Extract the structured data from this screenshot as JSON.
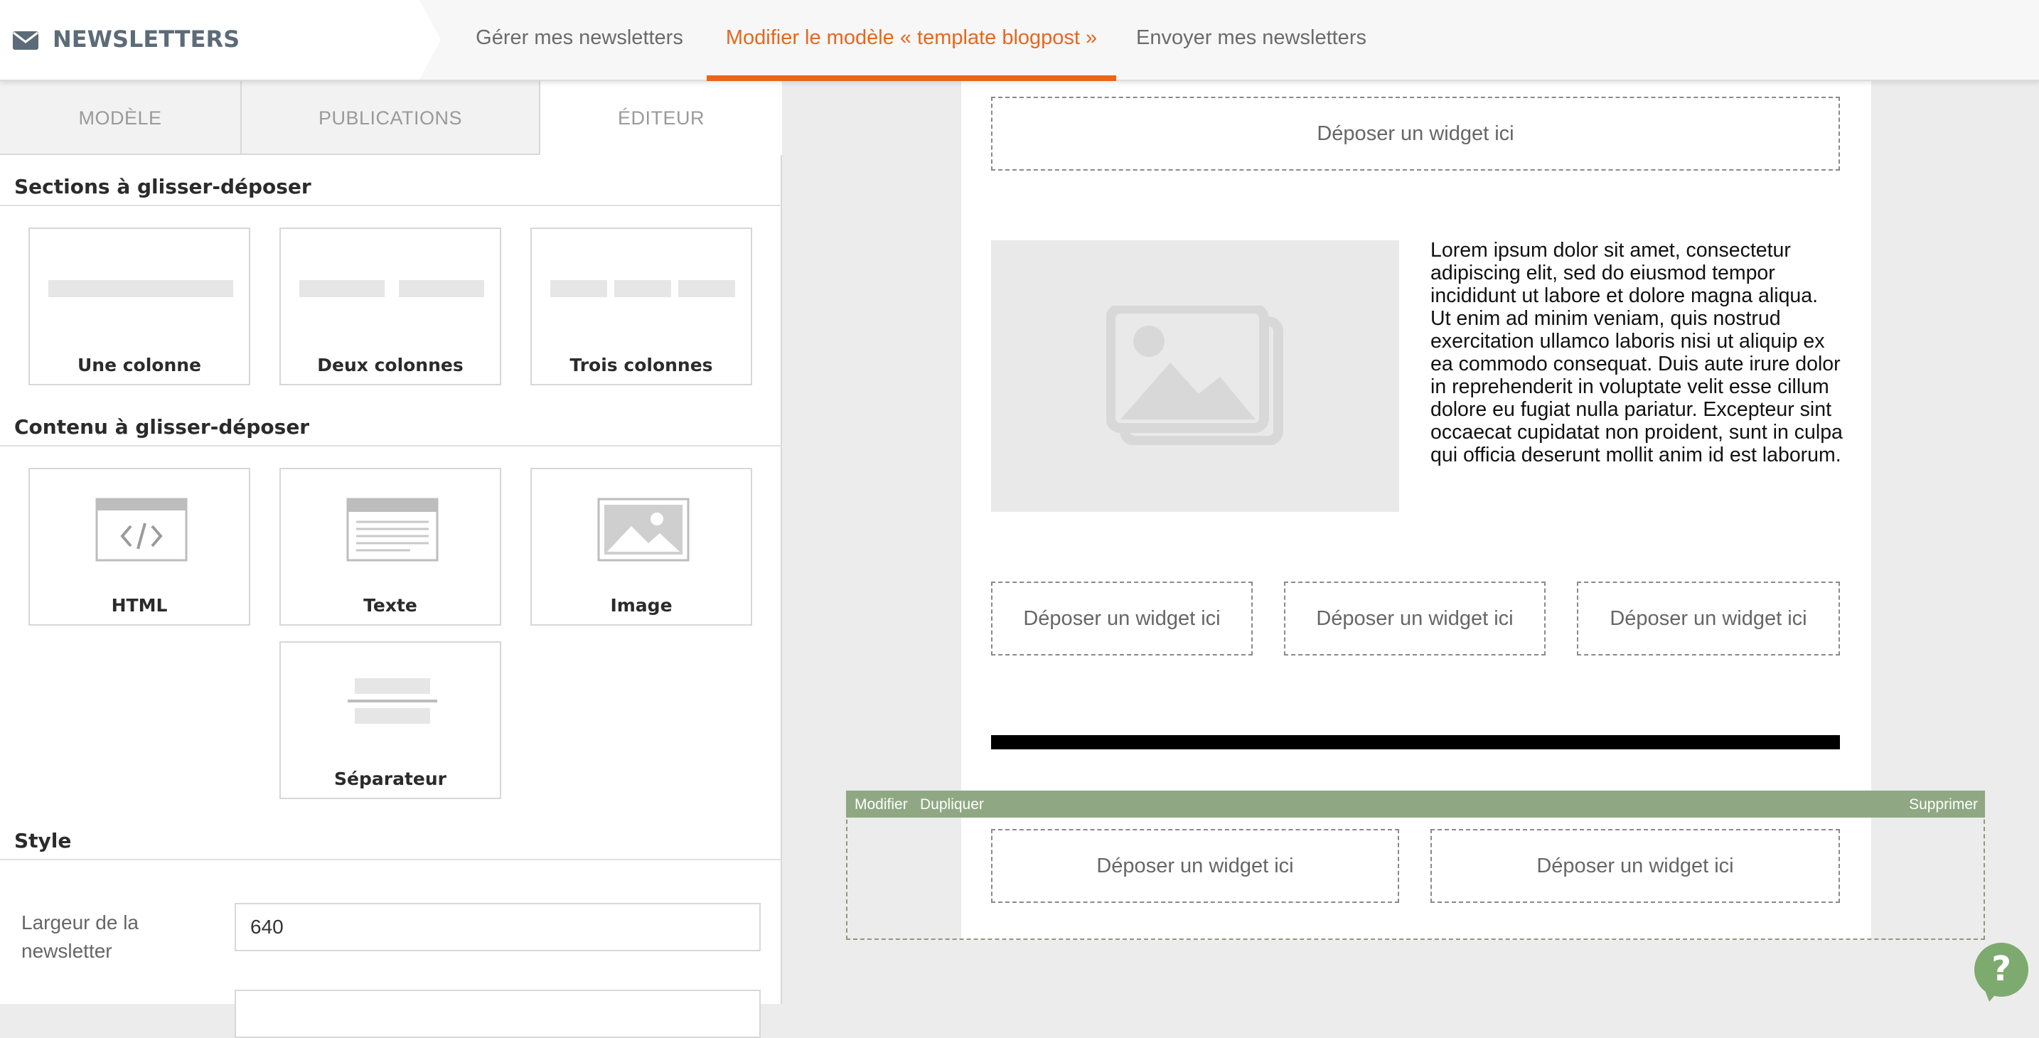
{
  "header": {
    "app_title": "NEWSLETTERS",
    "app_icon": "envelope-icon",
    "tabs": [
      {
        "label": "Gérer mes newsletters",
        "active": false
      },
      {
        "label": "Modifier le modèle « template blogpost »",
        "active": true
      },
      {
        "label": "Envoyer mes newsletters",
        "active": false
      }
    ],
    "accent_color": "#e8661d"
  },
  "left_panel": {
    "tabs": [
      {
        "label": "MODÈLE",
        "active": false
      },
      {
        "label": "PUBLICATIONS",
        "active": false
      },
      {
        "label": "ÉDITEUR",
        "active": true
      }
    ],
    "sections_title": "Sections à glisser-déposer",
    "sections": [
      {
        "label": "Une colonne"
      },
      {
        "label": "Deux colonnes"
      },
      {
        "label": "Trois colonnes"
      }
    ],
    "content_title": "Contenu à glisser-déposer",
    "content": [
      {
        "label": "HTML",
        "icon": "code-icon"
      },
      {
        "label": "Texte",
        "icon": "text-block-icon"
      },
      {
        "label": "Image",
        "icon": "image-icon"
      },
      {
        "label": "Séparateur",
        "icon": "separator-icon"
      }
    ],
    "style_title": "Style",
    "style": {
      "width_label": "Largeur de la newsletter",
      "width_value": "640"
    }
  },
  "canvas": {
    "dropzone_label": "Déposer un widget ici",
    "lorem": "Lorem ipsum dolor sit amet, consectetur adipiscing elit, sed do eiusmod tempor incididunt ut labore et dolore magna aliqua. Ut enim ad minim veniam, quis nostrud exercitation ullamco laboris nisi ut aliquip ex ea commodo consequat. Duis aute irure dolor in reprehenderit in voluptate velit esse cillum dolore eu fugiat nulla pariatur. Excepteur sint occaecat cupidatat non proident, sunt in culpa qui officia deserunt mollit anim id est laborum.",
    "section_toolbar": {
      "edit": "Modifier",
      "duplicate": "Dupliquer",
      "delete": "Supprimer",
      "color": "#8fa883"
    }
  },
  "help_button": {
    "label": "?",
    "icon": "help-icon"
  }
}
